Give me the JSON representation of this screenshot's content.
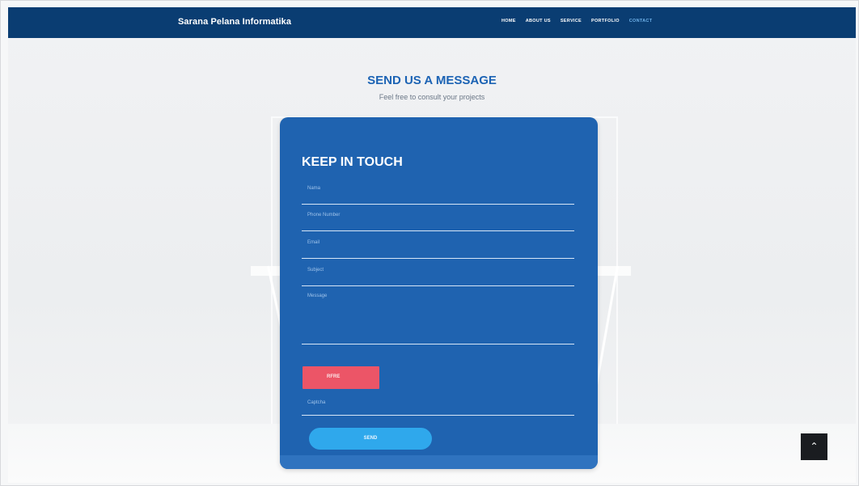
{
  "header": {
    "brand": "Sarana Pelana Informatika",
    "nav": [
      "HOME",
      "ABOUT US",
      "SERVICE",
      "PORTFOLIO",
      "CONTACT"
    ],
    "active_nav": "CONTACT"
  },
  "section": {
    "title": "SEND US A MESSAGE",
    "subtitle": "Feel free to consult your projects"
  },
  "form": {
    "title": "KEEP IN TOUCH",
    "fields": [
      {
        "placeholder": "Nama"
      },
      {
        "placeholder": "Phone Number"
      },
      {
        "placeholder": "Email"
      },
      {
        "placeholder": "Subject"
      },
      {
        "placeholder": "Message"
      }
    ],
    "captcha_button": "RFRE",
    "captcha_placeholder": "Captcha",
    "submit_button": "SEND"
  },
  "scroll_top_icon": "chevron-up-icon",
  "colors": {
    "navbar": "#0a3d72",
    "card": "#1f63b0",
    "heading": "#1c63b4",
    "refresh_button": "#ec5567",
    "send_button": "#2fa8ec",
    "scroll_top": "#1a1c20"
  }
}
